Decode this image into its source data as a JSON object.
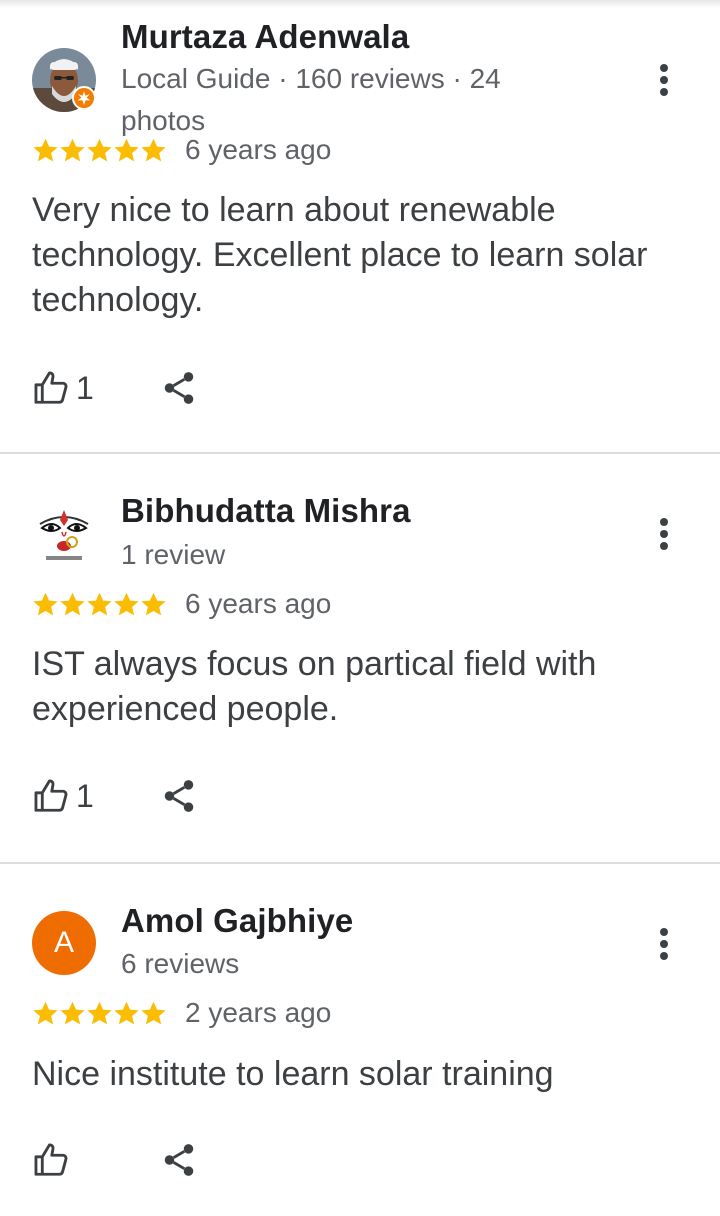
{
  "colors": {
    "star": "#fbbc04",
    "avatar_orange": "#ef6c00",
    "divider": "#dadce0",
    "secondary_text": "#5f6368"
  },
  "icons": {
    "like": "thumb-up-outline-icon",
    "share": "share-icon",
    "more": "more-vert-icon",
    "star": "star-icon",
    "local_guide": "local-guide-badge-icon"
  },
  "reviews": [
    {
      "name": "Murtaza Adenwala",
      "meta": "Local Guide · 160 reviews · 24 photos",
      "rating": 5,
      "date": "6 years ago",
      "text": "Very nice to learn about renewable technology. Excellent place to learn solar technology.",
      "likes": "1"
    },
    {
      "name": "Bibhudatta Mishra",
      "meta": "1 review",
      "rating": 5,
      "date": "6 years ago",
      "text": "IST always focus on partical field with experienced people.",
      "likes": "1"
    },
    {
      "name": "Amol Gajbhiye",
      "avatar_letter": "A",
      "meta": "6 reviews",
      "rating": 5,
      "date": "2 years ago",
      "text": "Nice institute to learn solar training",
      "likes": ""
    }
  ]
}
